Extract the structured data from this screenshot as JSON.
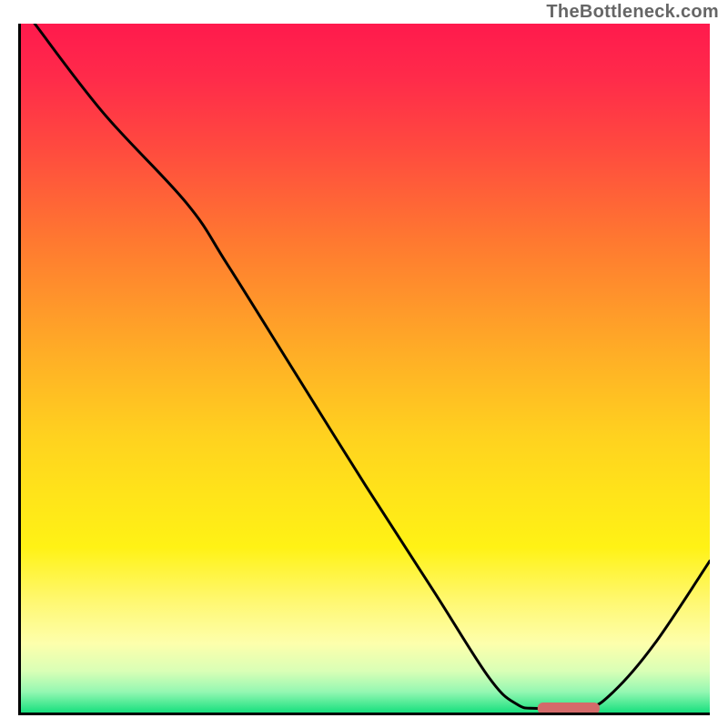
{
  "watermark": "TheBottleneck.com",
  "chart_data": {
    "type": "line",
    "title": "",
    "xlabel": "",
    "ylabel": "",
    "xlim": [
      0,
      100
    ],
    "ylim": [
      0,
      100
    ],
    "grid": false,
    "legend": false,
    "annotations": [],
    "background_gradient": {
      "top": "#ff1a4d",
      "bottom": "#18e07e",
      "meaning": "red-high to green-low"
    },
    "series": [
      {
        "name": "curve",
        "color": "#000000",
        "points_xy": [
          [
            2,
            100
          ],
          [
            12,
            87
          ],
          [
            24,
            74
          ],
          [
            30,
            65
          ],
          [
            40,
            49
          ],
          [
            50,
            33
          ],
          [
            60,
            17.5
          ],
          [
            68,
            5
          ],
          [
            72,
            1.2
          ],
          [
            75,
            0.6
          ],
          [
            82,
            0.6
          ],
          [
            86,
            3
          ],
          [
            92,
            10
          ],
          [
            100,
            22
          ]
        ]
      }
    ],
    "marker": {
      "shape": "rounded-bar",
      "color": "#d46a6a",
      "x_start": 75,
      "x_end": 84,
      "y": 0.6
    }
  }
}
